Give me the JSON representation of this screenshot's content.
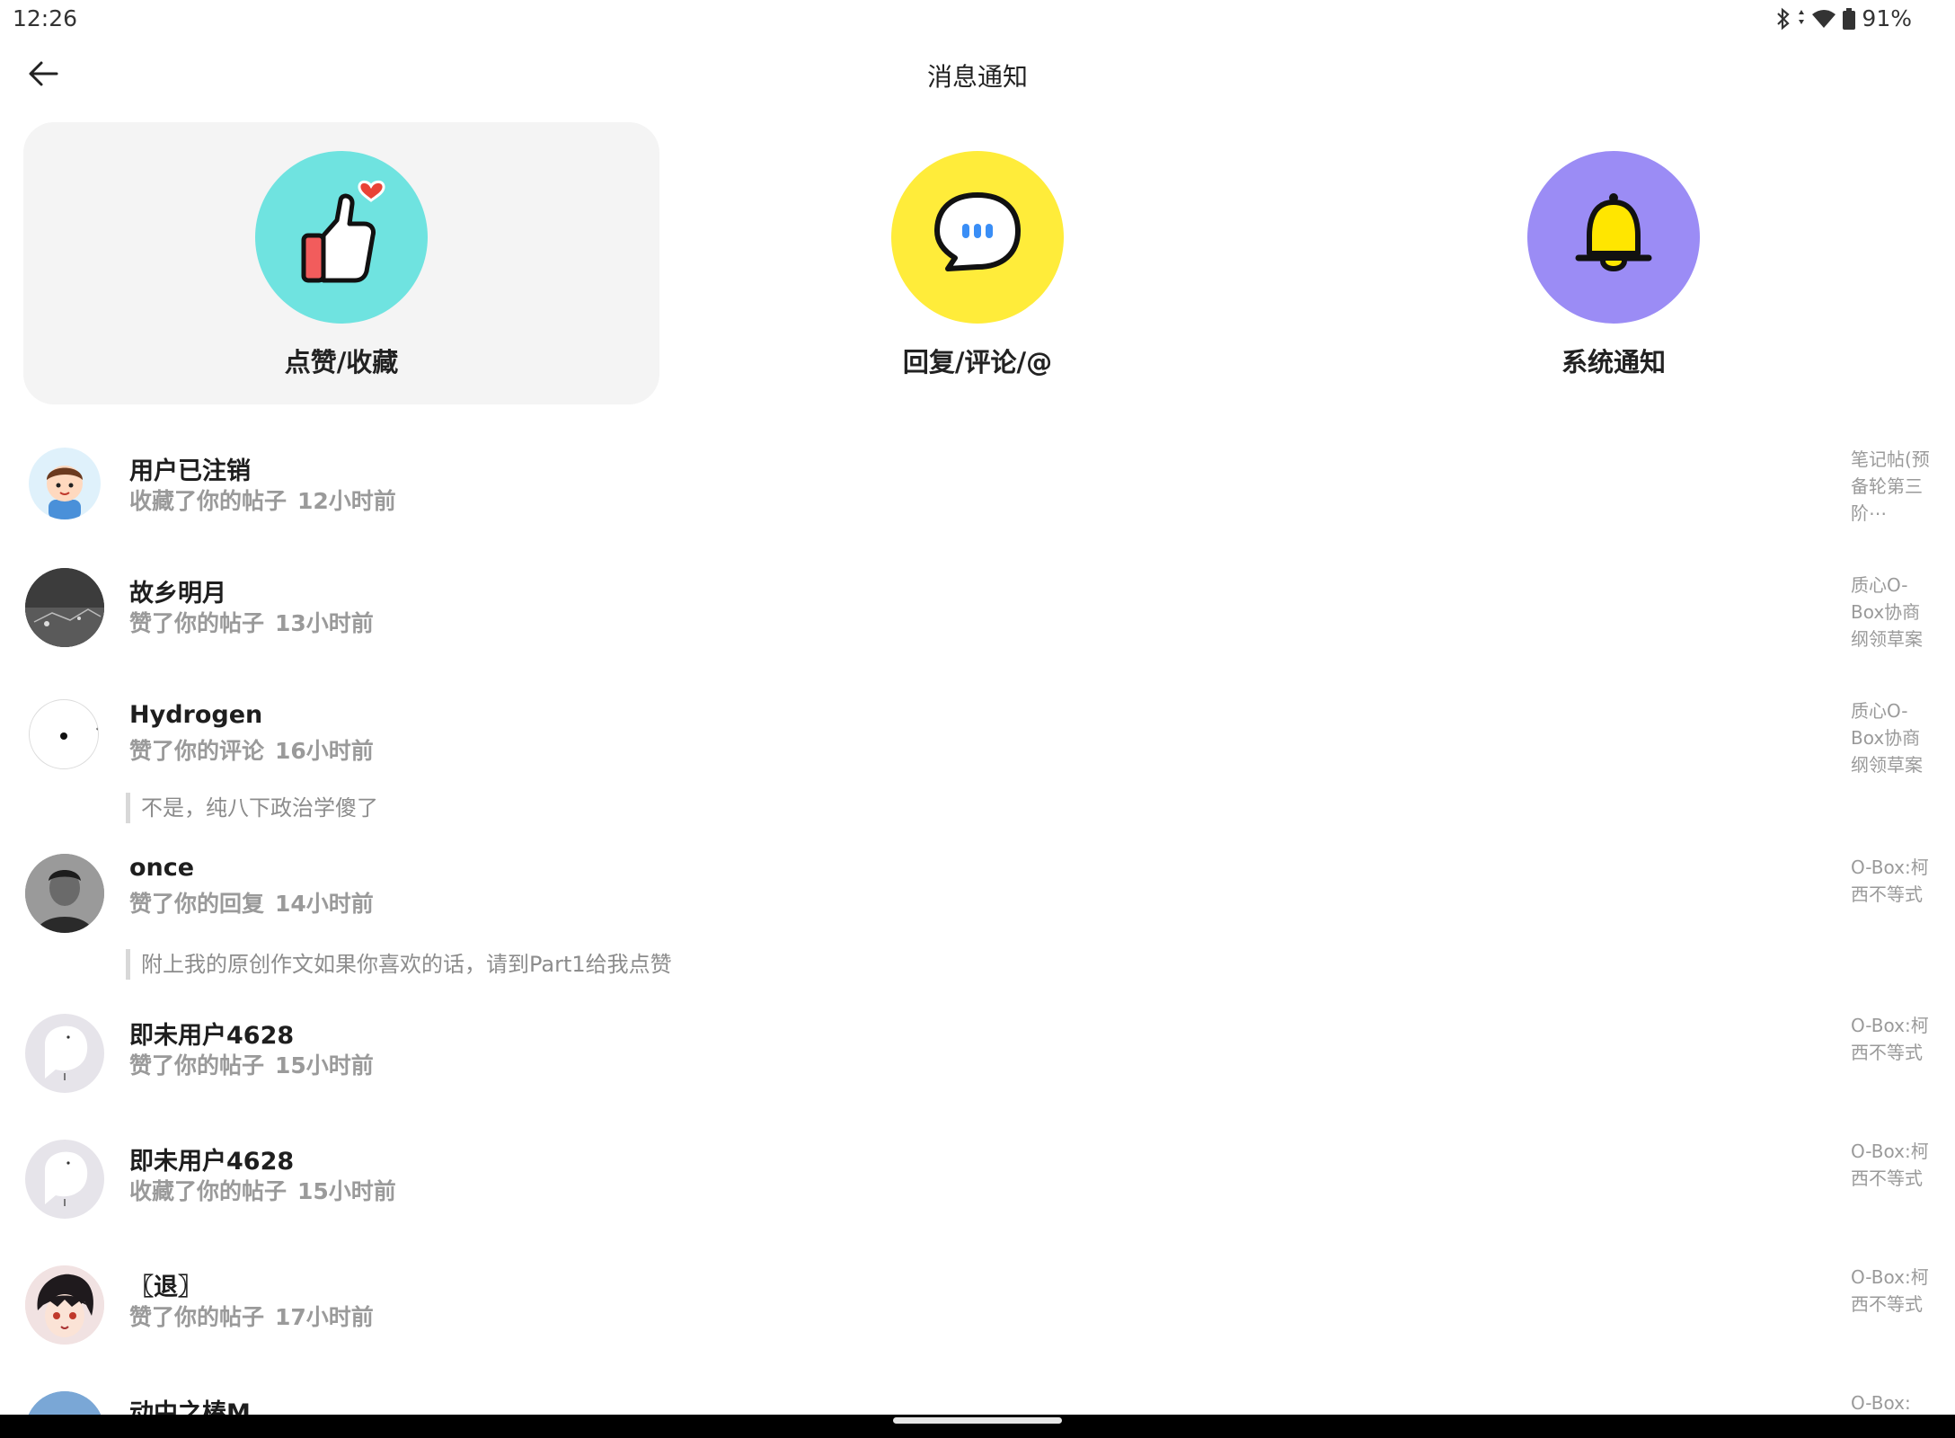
{
  "status_bar": {
    "time": "12:26",
    "battery": "91%"
  },
  "header": {
    "title": "消息通知"
  },
  "categories": [
    {
      "label": "点赞/收藏",
      "color": "#6fe3e0",
      "icon": "thumbs-up-heart-icon"
    },
    {
      "label": "回复/评论/@",
      "color": "#ffec3a",
      "icon": "chat-bubble-icon"
    },
    {
      "label": "系统通知",
      "color": "#9b8cf5",
      "icon": "bell-icon"
    }
  ],
  "notifications": [
    {
      "name": "用户已注销",
      "action": "收藏了你的帖子",
      "time": "12小时前",
      "quote": "",
      "post": "笔记帖(预备轮第三阶⋯"
    },
    {
      "name": "故乡明月",
      "action": "赞了你的帖子",
      "time": "13小时前",
      "quote": "",
      "post": "质心O-Box协商纲领草案"
    },
    {
      "name": "Hydrogen",
      "action": "赞了你的评论",
      "time": "16小时前",
      "quote": "不是，纯八下政治学傻了",
      "post": "质心O-Box协商纲领草案"
    },
    {
      "name": "once",
      "action": "赞了你的回复",
      "time": "14小时前",
      "quote": "附上我的原创作文如果你喜欢的话，请到Part1给我点赞",
      "post": "O-Box:柯西不等式"
    },
    {
      "name": "即未用户4628",
      "action": "赞了你的帖子",
      "time": "15小时前",
      "quote": "",
      "post": "O-Box:柯西不等式"
    },
    {
      "name": "即未用户4628",
      "action": "收藏了你的帖子",
      "time": "15小时前",
      "quote": "",
      "post": "O-Box:柯西不等式"
    },
    {
      "name": "〖退〗",
      "action": "赞了你的帖子",
      "time": "17小时前",
      "quote": "",
      "post": "O-Box:柯西不等式"
    },
    {
      "name": "动中之椿M",
      "action": "",
      "time": "",
      "quote": "",
      "post": "O-Box:"
    }
  ]
}
